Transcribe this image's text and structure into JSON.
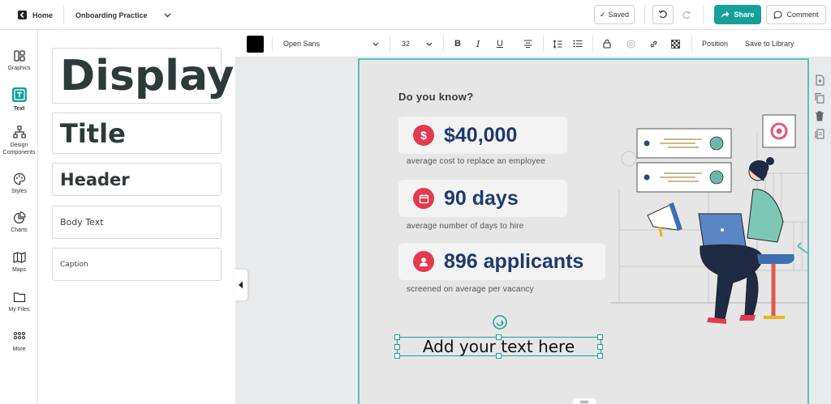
{
  "topbar": {
    "home_label": "Home",
    "project_title": "Onboarding Practice",
    "saved_label": "Saved",
    "share_label": "Share",
    "comment_label": "Comment"
  },
  "nav": {
    "items": [
      {
        "label": "Graphics",
        "icon": "graphics-icon"
      },
      {
        "label": "Text",
        "icon": "text-icon",
        "active": true
      },
      {
        "label": "Design Components",
        "icon": "components-icon"
      },
      {
        "label": "Styles",
        "icon": "palette-icon"
      },
      {
        "label": "Charts",
        "icon": "pie-chart-icon"
      },
      {
        "label": "Maps",
        "icon": "map-icon"
      },
      {
        "label": "My Files",
        "icon": "folder-icon"
      },
      {
        "label": "More",
        "icon": "grid-icon"
      }
    ]
  },
  "text_panel": {
    "display": "Display",
    "title": "Title",
    "header": "Header",
    "body": "Body Text",
    "caption": "Caption"
  },
  "format_bar": {
    "color": "#000000",
    "font": "Open Sans",
    "size": "32",
    "position_label": "Position",
    "save_library_label": "Save to Library"
  },
  "canvas": {
    "heading": "Do you know?",
    "stats": [
      {
        "value": "$40,000",
        "caption": "average cost to replace an employee",
        "icon": "dollar-icon"
      },
      {
        "value": "90 days",
        "caption": "average number of days to hire",
        "icon": "calendar-icon"
      },
      {
        "value": "896 applicants",
        "caption": "screened on average per vacancy",
        "icon": "user-icon"
      }
    ],
    "textbox": "Add your text here"
  },
  "colors": {
    "accent": "#15a19a",
    "selection": "#52c3bd",
    "stat_value": "#1e3a6b",
    "stat_icon": "#e23a50"
  }
}
